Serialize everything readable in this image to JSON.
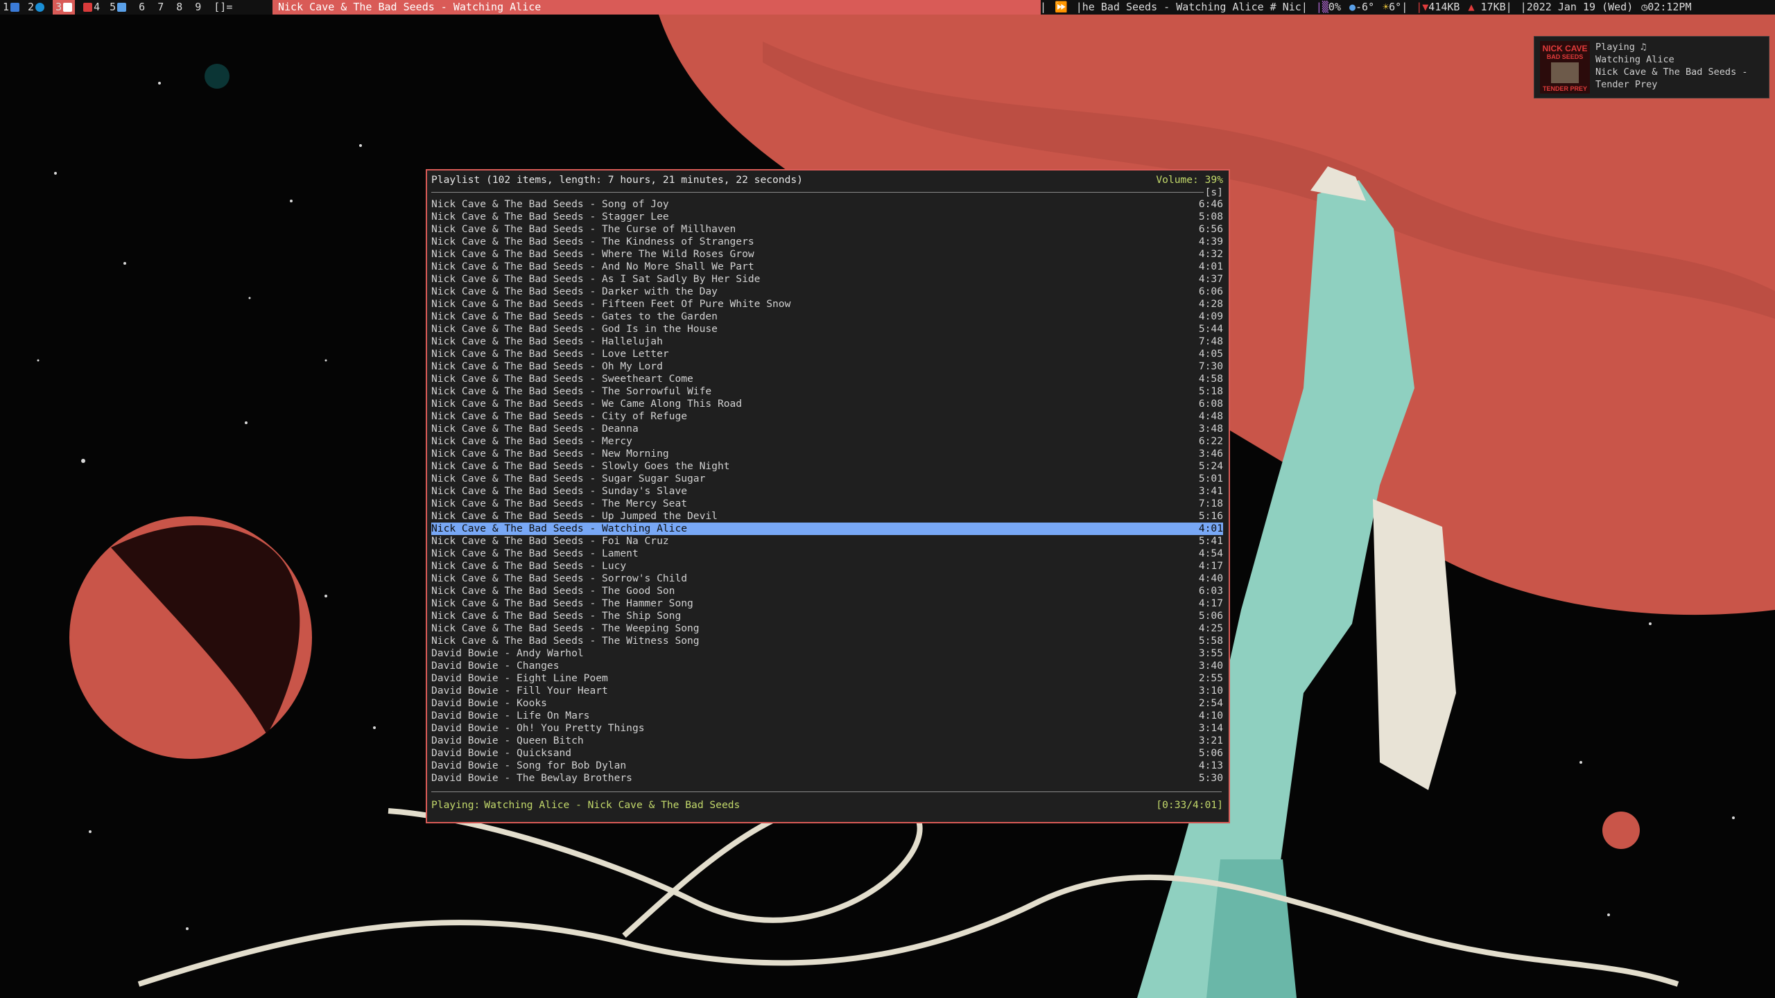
{
  "topbar": {
    "workspaces": [
      "1",
      "2",
      "3",
      "4",
      "5",
      "6",
      "7",
      "8",
      "9"
    ],
    "layout": "[]=",
    "window_title": "Nick Cave & The Bad Seeds - Watching Alice",
    "ticker": "|he Bad Seeds - Watching Alice # Nic|",
    "sys_a": "0%",
    "sys_b": "-6°",
    "sys_c": "6°|",
    "net_down": "414KB",
    "net_up": "17KB|",
    "date": "|2022 Jan 19 (Wed)",
    "time": "02:12PM",
    "colors": {
      "accent": "#d95b57",
      "bar": "#111111"
    }
  },
  "notification": {
    "album_art_lines": [
      "NICK CAVE",
      "BAD SEEDS",
      "TENDER PREY"
    ],
    "status": "Playing ♫",
    "track": "Watching Alice",
    "artist_album": "Nick Cave & The Bad Seeds -",
    "album": "Tender Prey"
  },
  "player": {
    "playlist_summary": "Playlist (102 items, length: 7 hours, 21 minutes, 22 seconds)",
    "volume": "Volume: 39%",
    "sort_flag": "[s]",
    "playing_label": "Playing:",
    "now_playing": "Watching Alice - Nick Cave & The Bad Seeds",
    "elapsed": "[0:33/4:01]",
    "selected_index": 26,
    "colors": {
      "selection": "#78a8f6",
      "highlight": "#c3d96b",
      "border": "#d95b57"
    },
    "tracks": [
      {
        "title": "Nick Cave & The Bad Seeds - Song of Joy",
        "duration": "6:46"
      },
      {
        "title": "Nick Cave & The Bad Seeds - Stagger Lee",
        "duration": "5:08"
      },
      {
        "title": "Nick Cave & The Bad Seeds - The Curse of Millhaven",
        "duration": "6:56"
      },
      {
        "title": "Nick Cave & The Bad Seeds - The Kindness of Strangers",
        "duration": "4:39"
      },
      {
        "title": "Nick Cave & The Bad Seeds - Where The Wild Roses Grow",
        "duration": "4:32"
      },
      {
        "title": "Nick Cave & The Bad Seeds - And No More Shall We Part",
        "duration": "4:01"
      },
      {
        "title": "Nick Cave & The Bad Seeds - As I Sat Sadly By Her Side",
        "duration": "4:37"
      },
      {
        "title": "Nick Cave & The Bad Seeds - Darker with the Day",
        "duration": "6:06"
      },
      {
        "title": "Nick Cave & The Bad Seeds - Fifteen Feet Of Pure White Snow",
        "duration": "4:28"
      },
      {
        "title": "Nick Cave & The Bad Seeds - Gates to the Garden",
        "duration": "4:09"
      },
      {
        "title": "Nick Cave & The Bad Seeds - God Is in the House",
        "duration": "5:44"
      },
      {
        "title": "Nick Cave & The Bad Seeds - Hallelujah",
        "duration": "7:48"
      },
      {
        "title": "Nick Cave & The Bad Seeds - Love Letter",
        "duration": "4:05"
      },
      {
        "title": "Nick Cave & The Bad Seeds - Oh My Lord",
        "duration": "7:30"
      },
      {
        "title": "Nick Cave & The Bad Seeds - Sweetheart Come",
        "duration": "4:58"
      },
      {
        "title": "Nick Cave & The Bad Seeds - The Sorrowful Wife",
        "duration": "5:18"
      },
      {
        "title": "Nick Cave & The Bad Seeds - We Came Along This Road",
        "duration": "6:08"
      },
      {
        "title": "Nick Cave & The Bad Seeds - City of Refuge",
        "duration": "4:48"
      },
      {
        "title": "Nick Cave & The Bad Seeds - Deanna",
        "duration": "3:48"
      },
      {
        "title": "Nick Cave & The Bad Seeds - Mercy",
        "duration": "6:22"
      },
      {
        "title": "Nick Cave & The Bad Seeds - New Morning",
        "duration": "3:46"
      },
      {
        "title": "Nick Cave & The Bad Seeds - Slowly Goes the Night",
        "duration": "5:24"
      },
      {
        "title": "Nick Cave & The Bad Seeds - Sugar Sugar Sugar",
        "duration": "5:01"
      },
      {
        "title": "Nick Cave & The Bad Seeds - Sunday's Slave",
        "duration": "3:41"
      },
      {
        "title": "Nick Cave & The Bad Seeds - The Mercy Seat",
        "duration": "7:18"
      },
      {
        "title": "Nick Cave & The Bad Seeds - Up Jumped the Devil",
        "duration": "5:16"
      },
      {
        "title": "Nick Cave & The Bad Seeds - Watching Alice",
        "duration": "4:01"
      },
      {
        "title": "Nick Cave & The Bad Seeds - Foi Na Cruz",
        "duration": "5:41"
      },
      {
        "title": "Nick Cave & The Bad Seeds - Lament",
        "duration": "4:54"
      },
      {
        "title": "Nick Cave & The Bad Seeds - Lucy",
        "duration": "4:17"
      },
      {
        "title": "Nick Cave & The Bad Seeds - Sorrow's Child",
        "duration": "4:40"
      },
      {
        "title": "Nick Cave & The Bad Seeds - The Good Son",
        "duration": "6:03"
      },
      {
        "title": "Nick Cave & The Bad Seeds - The Hammer Song",
        "duration": "4:17"
      },
      {
        "title": "Nick Cave & The Bad Seeds - The Ship Song",
        "duration": "5:06"
      },
      {
        "title": "Nick Cave & The Bad Seeds - The Weeping Song",
        "duration": "4:25"
      },
      {
        "title": "Nick Cave & The Bad Seeds - The Witness Song",
        "duration": "5:58"
      },
      {
        "title": "David Bowie - Andy Warhol",
        "duration": "3:55"
      },
      {
        "title": "David Bowie - Changes",
        "duration": "3:40"
      },
      {
        "title": "David Bowie - Eight Line Poem",
        "duration": "2:55"
      },
      {
        "title": "David Bowie - Fill Your Heart",
        "duration": "3:10"
      },
      {
        "title": "David Bowie - Kooks",
        "duration": "2:54"
      },
      {
        "title": "David Bowie - Life On Mars",
        "duration": "4:10"
      },
      {
        "title": "David Bowie - Oh! You Pretty Things",
        "duration": "3:14"
      },
      {
        "title": "David Bowie - Queen Bitch",
        "duration": "3:21"
      },
      {
        "title": "David Bowie - Quicksand",
        "duration": "5:06"
      },
      {
        "title": "David Bowie - Song for Bob Dylan",
        "duration": "4:13"
      },
      {
        "title": "David Bowie - The Bewlay Brothers",
        "duration": "5:30"
      }
    ]
  }
}
